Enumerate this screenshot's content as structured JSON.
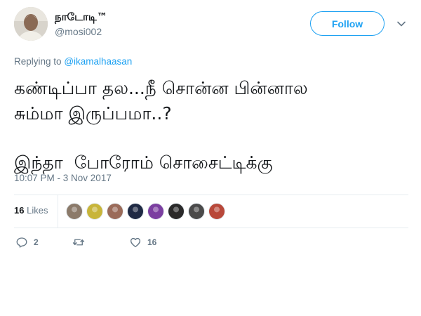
{
  "user": {
    "display_name": "நாடோடி™",
    "screen_name": "@mosi002",
    "avatar_icon": "user-avatar-photo"
  },
  "follow_button": {
    "label": "Follow",
    "color": "#1da1f2"
  },
  "caret_icon": "chevron-down-icon",
  "reply_context": {
    "prefix": "Replying to",
    "mention": "@ikamalhaasan"
  },
  "tweet": {
    "lines": [
      "கண்டிப்பா தல...நீ சொன்ன பின்னால",
      "சும்மா இருப்பமா..?",
      "இந்தா  போரோம் சொசைட்டிக்கு"
    ]
  },
  "timestamp": "10:07 PM - 3 Nov 2017",
  "stats": {
    "likes_count": "16",
    "likes_label": "Likes"
  },
  "likers": [
    {
      "color": "#8b7a6a"
    },
    {
      "color": "#c8b53a"
    },
    {
      "color": "#9a6b5a"
    },
    {
      "color": "#1f2a44"
    },
    {
      "color": "#7b3fa0"
    },
    {
      "color": "#2a2a2a"
    },
    {
      "color": "#4a4a4a"
    },
    {
      "color": "#b8483a"
    }
  ],
  "actions": {
    "reply_count": "2",
    "retweet_count": "",
    "like_count": "16",
    "reply_icon": "reply-icon",
    "retweet_icon": "retweet-icon",
    "like_icon": "heart-icon"
  }
}
